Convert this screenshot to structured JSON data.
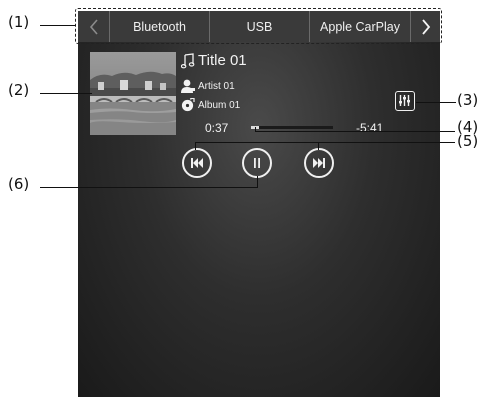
{
  "callouts": {
    "c1": "(1)",
    "c2": "(2)",
    "c3": "(3)",
    "c4": "(4)",
    "c5": "(5)",
    "c6": "(6)"
  },
  "tabbar": {
    "prev_icon": "chevron-left-icon",
    "next_icon": "chevron-right-icon",
    "sources": [
      "Bluetooth",
      "USB",
      "Apple CarPlay"
    ]
  },
  "track": {
    "title": "Title 01",
    "artist": "Artist 01",
    "album": "Album 01",
    "title_icon": "music-note-icon",
    "artist_icon": "person-icon",
    "album_icon": "disc-icon"
  },
  "progress": {
    "elapsed": "0:37",
    "remaining": "-5:41",
    "fraction": 0.1
  },
  "controls": {
    "previous_icon": "skip-previous-icon",
    "pause_icon": "pause-icon",
    "next_icon": "skip-next-icon",
    "equalizer_icon": "equalizer-icon"
  },
  "colors": {
    "screen_bg": "#2e2e2e",
    "tabbar_bg": "#3a3a3a",
    "foreground": "#f0f0f0"
  }
}
